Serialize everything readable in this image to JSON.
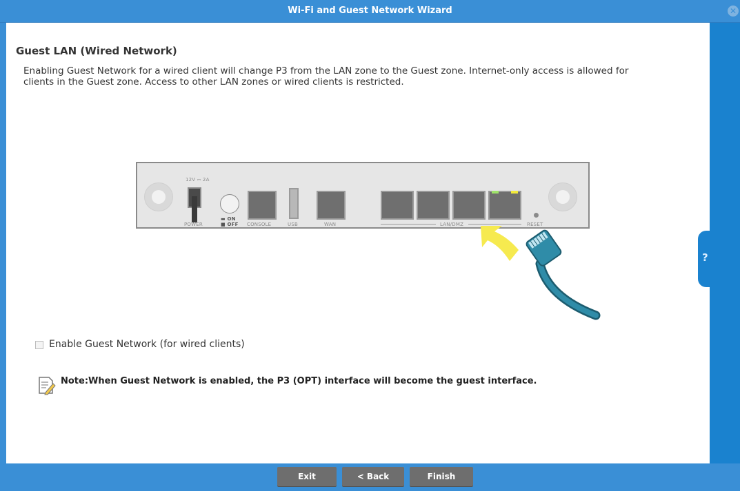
{
  "window": {
    "title": "Wi-Fi and Guest Network Wizard"
  },
  "page": {
    "heading": "Guest LAN (Wired Network)",
    "description": "Enabling Guest Network for a wired client will change P3 from the LAN zone to the Guest zone. Internet-only access is allowed for clients in the Guest zone. Access to other LAN zones or wired clients is restricted."
  },
  "device": {
    "power_rating": "12V ⎓ 2A",
    "labels": {
      "power": "POWER",
      "switch_on": "ON",
      "switch_off": "OFF",
      "console": "CONSOLE",
      "usb": "USB",
      "wan": "WAN",
      "lan_dmz": "LAN/DMZ",
      "reset": "RESET"
    }
  },
  "options": {
    "enable_guest_wired": {
      "label": "Enable Guest Network (for wired clients)",
      "checked": false
    }
  },
  "note": "Note:When Guest Network is enabled, the P3 (OPT) interface will become the guest interface.",
  "help": {
    "label": "?"
  },
  "footer": {
    "exit_label": "Exit",
    "back_label": "< Back",
    "finish_label": "Finish"
  },
  "colors": {
    "titlebar": "#3a8fd6",
    "side_panel": "#1a82cf",
    "arrow": "#f6ea4f",
    "cable": "#2f8ca8",
    "button": "#6e6e6e"
  }
}
